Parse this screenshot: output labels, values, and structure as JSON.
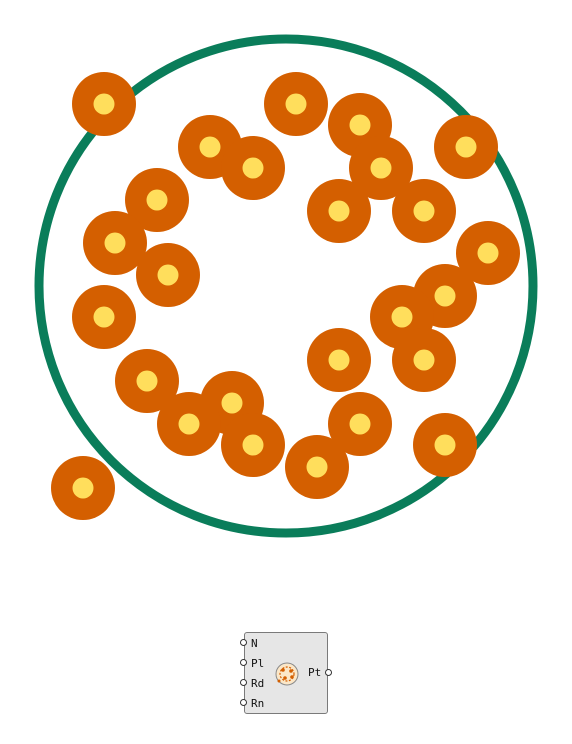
{
  "colors": {
    "boundary_stroke": "#0a7d5a",
    "point_outer": "#d45f00",
    "point_inner": "#ffde5c",
    "component_fill": "#e6e6e6",
    "component_border": "#7a7a7a"
  },
  "component": {
    "icon": "random-points-in-circle-icon",
    "inputs": [
      {
        "label": "N"
      },
      {
        "label": "Pl"
      },
      {
        "label": "Rd"
      },
      {
        "label": "Rn"
      }
    ],
    "output": {
      "label": "Pt"
    }
  }
}
